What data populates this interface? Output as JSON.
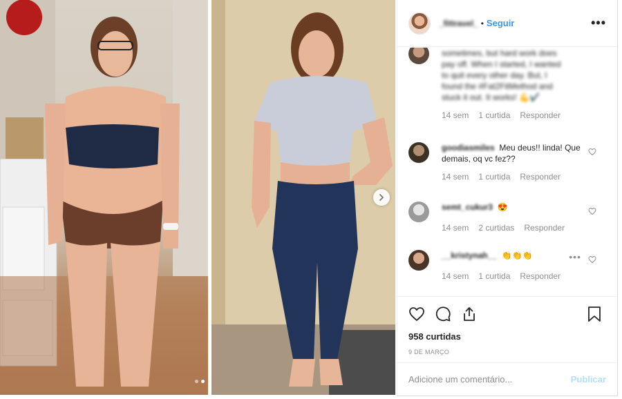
{
  "post": {
    "username": "_fittravel_",
    "follow_label": "Seguir",
    "separator": "•",
    "more_label": "•••"
  },
  "carousel": {
    "slides": 2,
    "current": 2
  },
  "comments": [
    {
      "user": "",
      "text_lines": [
        "sometimes, but hard work does",
        "pay off. When I started, I wanted",
        "to quit every other day. But, I",
        "found the #Fat2FitMethod and",
        "stuck it out. It works! 💪✔️"
      ],
      "time": "14 sem",
      "likes": "1 curtida",
      "reply": "Responder"
    },
    {
      "user": "goodiasmiles",
      "text": "Meu deus!! linda! Que demais, oq vc fez??",
      "time": "14 sem",
      "likes": "1 curtida",
      "reply": "Responder"
    },
    {
      "user": "semt_cukur3",
      "text": "😍",
      "time": "14 sem",
      "likes": "2 curtidas",
      "reply": "Responder"
    },
    {
      "user": "__kristynah__",
      "text": "👏👏👏",
      "time": "14 sem",
      "likes": "1 curtida",
      "reply": "Responder",
      "more": "•••"
    }
  ],
  "stats": {
    "likes": "958 curtidas",
    "date": "9 DE MARÇO"
  },
  "composer": {
    "placeholder": "Adicione um comentário...",
    "publish_label": "Publicar"
  },
  "colors": {
    "link_blue": "#3897f0",
    "meta_gray": "#8e8e8e",
    "publish_disabled": "#b2dffc"
  }
}
